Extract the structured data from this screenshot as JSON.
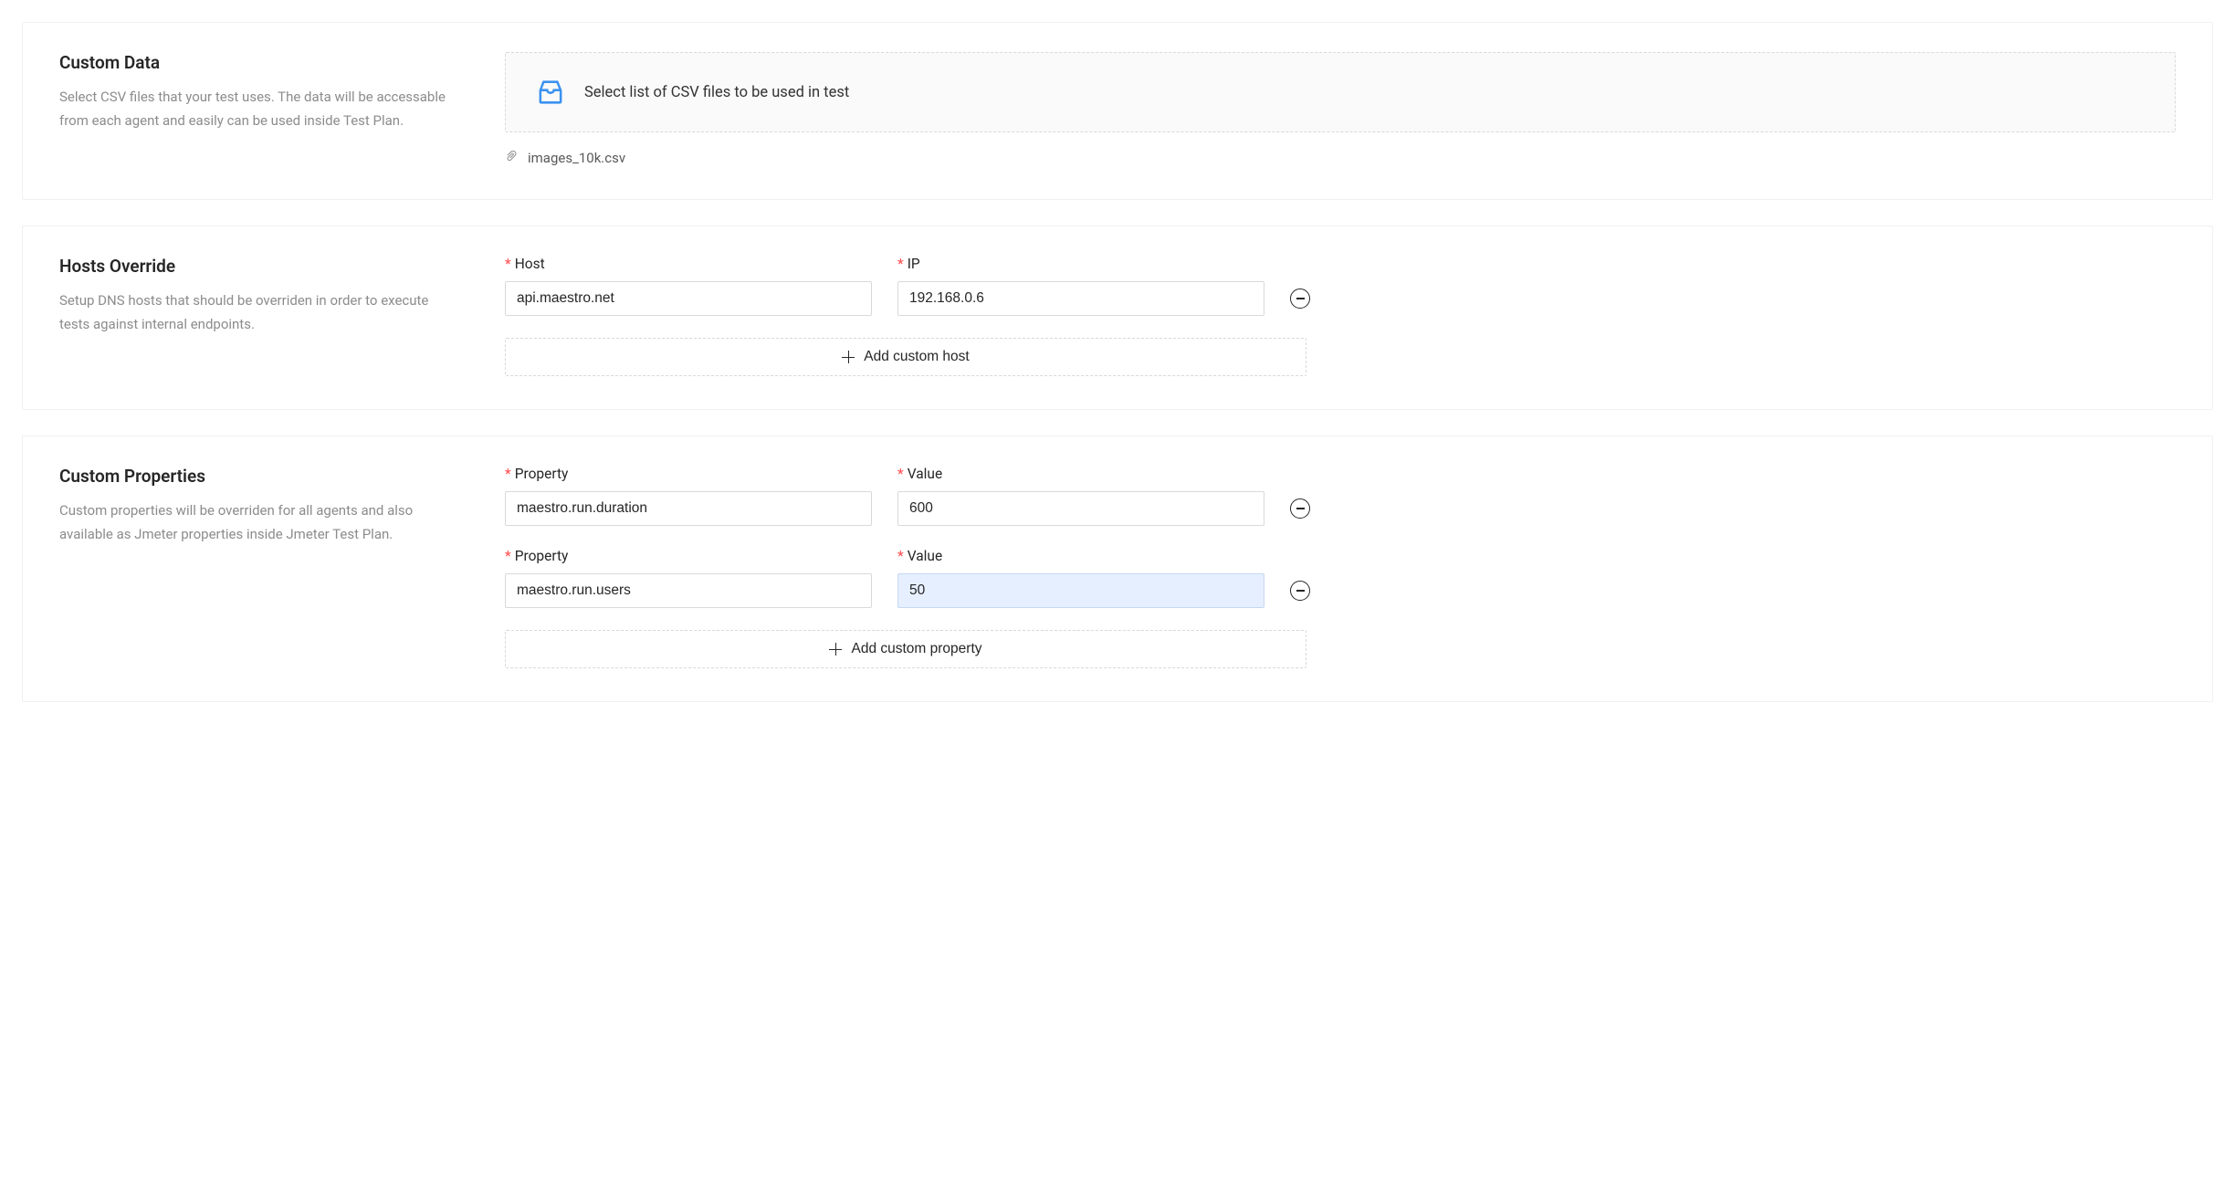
{
  "custom_data": {
    "title": "Custom Data",
    "description": "Select CSV files that your test uses. The data will be accessable from each agent and easily can be used inside Test Plan.",
    "dropzone_text": "Select list of CSV files to be used in test",
    "files": [
      {
        "name": "images_10k.csv"
      }
    ]
  },
  "hosts_override": {
    "title": "Hosts Override",
    "description": "Setup DNS hosts that should be overriden in order to execute tests against internal endpoints.",
    "host_label": "Host",
    "ip_label": "IP",
    "rows": [
      {
        "host": "api.maestro.net",
        "ip": "192.168.0.6"
      }
    ],
    "add_label": "Add custom host"
  },
  "custom_properties": {
    "title": "Custom Properties",
    "description": "Custom properties will be overriden for all agents and also available as Jmeter properties inside Jmeter Test Plan.",
    "property_label": "Property",
    "value_label": "Value",
    "rows": [
      {
        "property": "maestro.run.duration",
        "value": "600",
        "highlighted": false
      },
      {
        "property": "maestro.run.users",
        "value": "50",
        "highlighted": true
      }
    ],
    "add_label": "Add custom property"
  }
}
